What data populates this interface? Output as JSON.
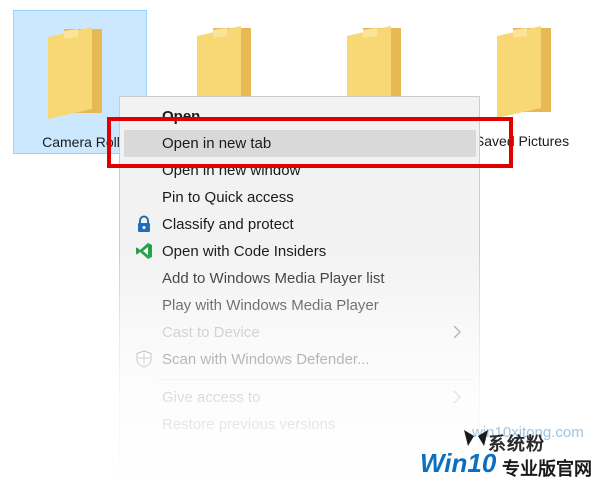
{
  "folders": [
    {
      "name": "Camera Roll",
      "selected": true
    },
    {
      "name": "",
      "selected": false
    },
    {
      "name": "",
      "selected": false
    },
    {
      "name": "Saved Pictures",
      "selected": false
    }
  ],
  "menu": {
    "items": [
      {
        "label": "Open",
        "bold": true
      },
      {
        "label": "Open in new tab",
        "hover": true
      },
      {
        "label": "Open in new window"
      },
      {
        "label": "Pin to Quick access"
      },
      {
        "label": "Classify and protect",
        "icon": "lock-icon"
      },
      {
        "label": "Open with Code Insiders",
        "icon": "vscode-insiders-icon"
      },
      {
        "label": "Add to Windows Media Player list"
      },
      {
        "label": "Play with Windows Media Player"
      },
      {
        "label": "Cast to Device",
        "submenu": true
      },
      {
        "label": "Scan with Windows Defender...",
        "icon": "defender-shield-icon"
      },
      {
        "label": "Give access to",
        "submenu": true
      },
      {
        "label": "Restore previous versions"
      }
    ]
  },
  "watermark": {
    "url": "win10xitong.com",
    "brand": "Win10",
    "brand_sub": "专业版官网",
    "tagline": "系统粉",
    "brand_color": "#0a6fc2"
  },
  "colors": {
    "folder_yellow": "#f8d775",
    "selection": "#cce8ff",
    "highlight_red": "#e00000",
    "menu_bg": "#f2f2f2"
  }
}
